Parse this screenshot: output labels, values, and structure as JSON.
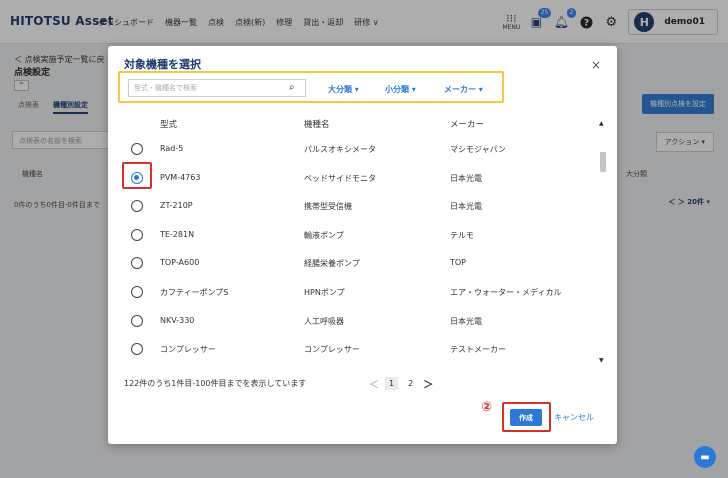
{
  "app": {
    "logo": "HITOTSU Asset",
    "nav": [
      "ダッシュボード",
      "機器一覧",
      "点検",
      "点検(新)",
      "修理",
      "貸出・返却",
      "研修 ∨"
    ],
    "menu_label": "MENU",
    "badge_msg": "25",
    "badge_notify": "2",
    "user_initial": "H",
    "username": "demo01"
  },
  "background": {
    "back_link": "＜ 点検実施予定一覧に戻",
    "page_title": "点検設定",
    "collapse": "⌃",
    "tabs": [
      "点検表",
      "機種別設定"
    ],
    "search_placeholder": "点検表の名前を検索",
    "table_header": "機種名",
    "count_text": "0件のうち0件目-0件目まで",
    "primary_button": "機種別点検を設定",
    "action_button": "アクション ▾",
    "col_header": "大分類",
    "pager": "＜ ＞ 20件 ▾"
  },
  "modal": {
    "title": "対象機種を選択",
    "close": "×",
    "search_placeholder": "型式・機種名で検索",
    "filters": [
      "大分類 ▾",
      "小分類 ▾",
      "メーカー ▾"
    ],
    "columns": [
      "型式",
      "機種名",
      "メーカー"
    ],
    "rows": [
      {
        "model": "Rad-5",
        "name": "パルスオキシメータ",
        "maker": "マシモジャパン",
        "checked": false
      },
      {
        "model": "PVM-4763",
        "name": "ベッドサイドモニタ",
        "maker": "日本光電",
        "checked": true
      },
      {
        "model": "ZT-210P",
        "name": "携帯型受信機",
        "maker": "日本光電",
        "checked": false
      },
      {
        "model": "TE-281N",
        "name": "輸液ポンプ",
        "maker": "テルモ",
        "checked": false
      },
      {
        "model": "TOP-A600",
        "name": "経腸栄養ポンプ",
        "maker": "TOP",
        "checked": false
      },
      {
        "model": "カフティーポンプS",
        "name": "HPNポンプ",
        "maker": "エア・ウォーター・メディカル",
        "checked": false
      },
      {
        "model": "NKV-330",
        "name": "人工呼吸器",
        "maker": "日本光電",
        "checked": false
      },
      {
        "model": "コンプレッサー",
        "name": "コンプレッサー",
        "maker": "テストメーカー",
        "checked": false
      }
    ],
    "count_text": "122件のうち1件目-100件目までを表示しています",
    "pager": {
      "prev": "＜",
      "pages": [
        "1",
        "2"
      ],
      "next": "＞"
    },
    "step_label": "②",
    "create_label": "作成",
    "cancel_label": "キャンセル"
  }
}
